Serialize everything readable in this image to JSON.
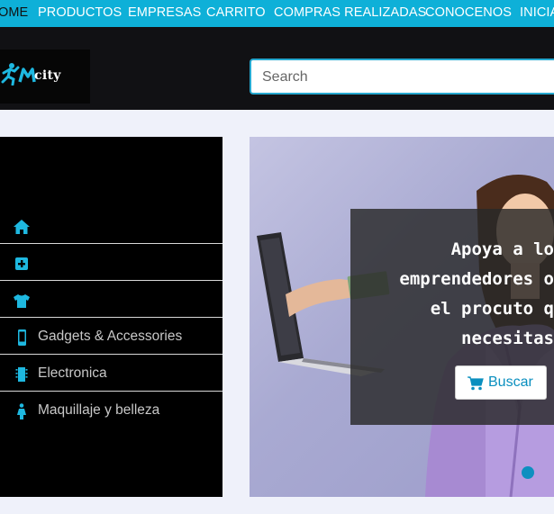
{
  "nav": {
    "items": [
      {
        "label": "OME",
        "active": true
      },
      {
        "label": "PRODUCTOS"
      },
      {
        "label": "EMPRESAS"
      },
      {
        "label": "CARRITO"
      },
      {
        "label": "COMPRAS REALIZADAS"
      },
      {
        "label": "CONOCENOS"
      },
      {
        "label": "INICIA"
      }
    ]
  },
  "header": {
    "logo_text": "city",
    "search_placeholder": "Search"
  },
  "sidebar": {
    "items": [
      {
        "label": "",
        "icon": "home-icon"
      },
      {
        "label": "",
        "icon": "plus-square-icon"
      },
      {
        "label": "",
        "icon": "tshirt-icon"
      },
      {
        "label": "Gadgets & Accessories",
        "icon": "mobile-icon"
      },
      {
        "label": "Electronica",
        "icon": "chip-icon"
      },
      {
        "label": "Maquillaje y belleza",
        "icon": "female-icon"
      }
    ]
  },
  "banner": {
    "lines": [
      "Apoya a lo",
      "emprendedores o",
      "el procuto q",
      "necesitas"
    ],
    "button_label": "Buscar",
    "button_icon": "cart-icon"
  },
  "colors": {
    "accent": "#0eb0d8",
    "icon_blue": "#1eb8e0",
    "button_text": "#0a8fbf"
  }
}
